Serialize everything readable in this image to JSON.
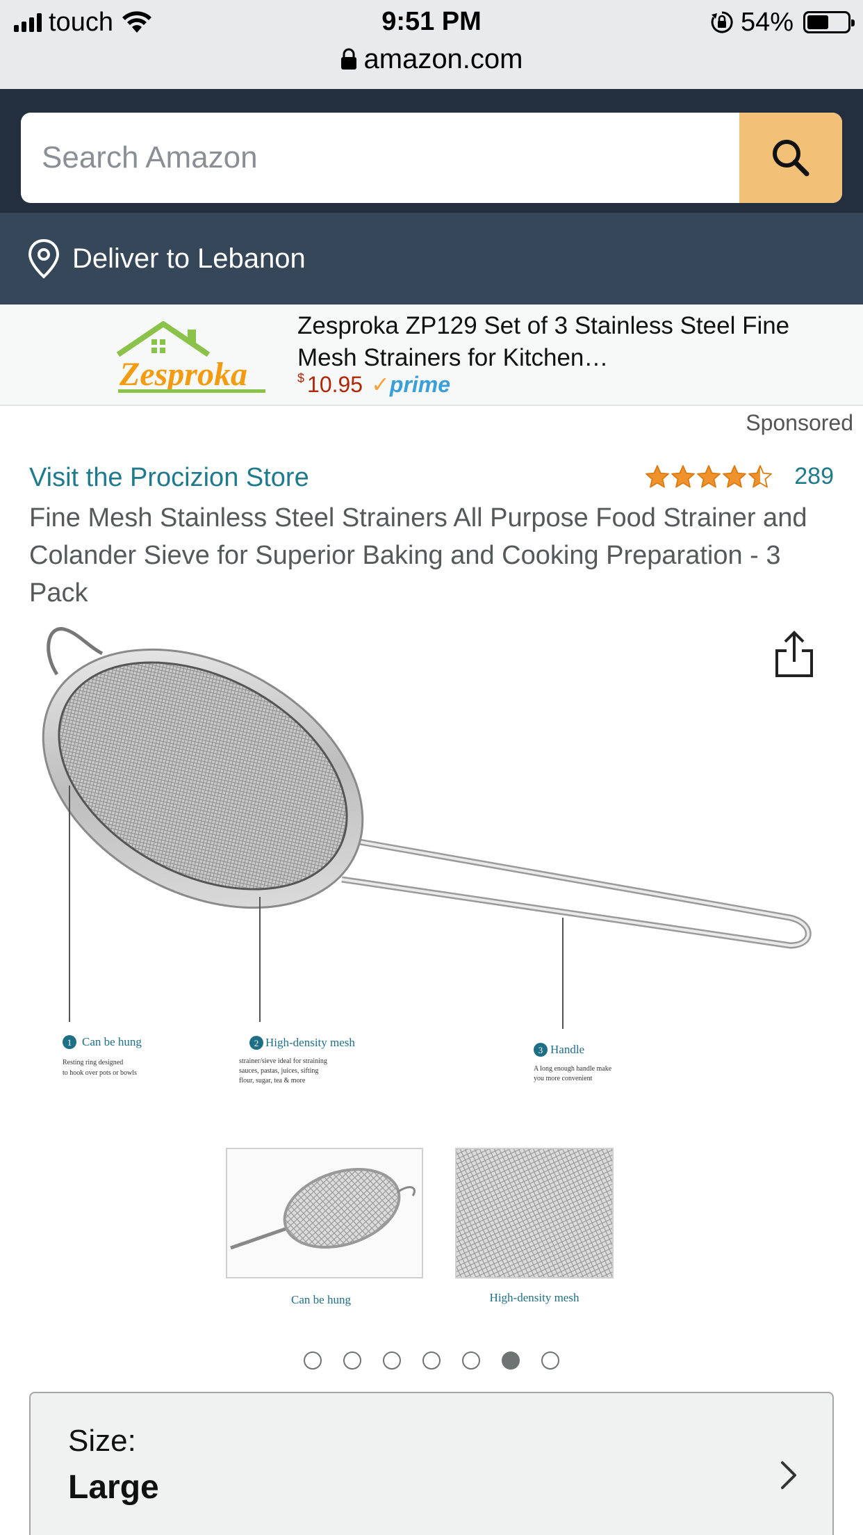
{
  "status_bar": {
    "carrier": "touch",
    "time": "9:51 PM",
    "battery_percent": "54%",
    "battery_level": 0.54,
    "url": "amazon.com"
  },
  "search": {
    "placeholder": "Search Amazon",
    "icon": "search-icon"
  },
  "delivery": {
    "text": "Deliver to Lebanon",
    "icon": "location-pin-icon"
  },
  "sponsored_ad": {
    "brand_logo_text": "Zesproka",
    "title": "Zesproka ZP129 Set of 3 Stainless Steel Fine Mesh Strainers for Kitchen…",
    "currency": "$",
    "price": "10.95",
    "prime_label": "prime",
    "sponsored_label": "Sponsored"
  },
  "product": {
    "store_link": "Visit the Procizion Store",
    "rating_stars": 4.5,
    "rating_count": "289",
    "title": "Fine Mesh Stainless Steel Strainers All Purpose Food Strainer and Colander Sieve for Superior Baking and Cooking Preparation - 3 Pack"
  },
  "image_callouts": {
    "callout_1": {
      "number": "1",
      "title": "Can be hung",
      "desc_1": "Resting ring designed",
      "desc_2": "to hook over pots or bowls"
    },
    "callout_2": {
      "number": "2",
      "title": "High-density mesh",
      "desc_1": "strainer/sieve ideal for straining",
      "desc_2": "sauces, pastas, juices, sifting",
      "desc_3": "flour, sugar, tea & more"
    },
    "callout_3": {
      "number": "3",
      "title": "Handle",
      "desc_1": "A long enough handle make",
      "desc_2": "you more convenient"
    },
    "thumb_1_caption": "Can be hung",
    "thumb_2_caption": "High-density mesh"
  },
  "carousel": {
    "total": 7,
    "active_index": 5
  },
  "size_selector": {
    "label": "Size:",
    "value": "Large"
  },
  "colors": {
    "header_dark": "#232f3e",
    "deliver_bar": "#37475a",
    "search_button": "#f3c078",
    "link_teal": "#1e7a8c",
    "price_red": "#b12704",
    "star_orange": "#f0922b"
  }
}
